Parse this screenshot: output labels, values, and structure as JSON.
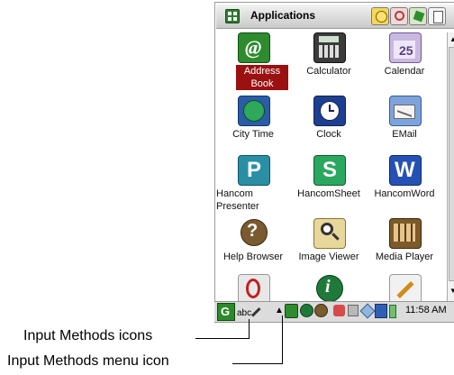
{
  "window": {
    "title": "Applications"
  },
  "apps": [
    {
      "label": "Address Book",
      "icon": "address-book-icon",
      "selected": true
    },
    {
      "label": "Calculator",
      "icon": "calculator-icon",
      "selected": false
    },
    {
      "label": "Calendar",
      "icon": "calendar-icon",
      "selected": false
    },
    {
      "label": "City Time",
      "icon": "city-time-icon",
      "selected": false
    },
    {
      "label": "Clock",
      "icon": "clock-icon",
      "selected": false
    },
    {
      "label": "EMail",
      "icon": "email-icon",
      "selected": false
    },
    {
      "label": "Hancom Presenter",
      "icon": "hancom-presenter-icon",
      "selected": false
    },
    {
      "label": "HancomSheet",
      "icon": "hancom-sheet-icon",
      "selected": false
    },
    {
      "label": "HancomWord",
      "icon": "hancom-word-icon",
      "selected": false
    },
    {
      "label": "Help Browser",
      "icon": "help-browser-icon",
      "selected": false
    },
    {
      "label": "Image Viewer",
      "icon": "image-viewer-icon",
      "selected": false
    },
    {
      "label": "Media Player",
      "icon": "media-player-icon",
      "selected": false
    },
    {
      "label": "",
      "icon": "partial-app-icon-1",
      "selected": false
    },
    {
      "label": "",
      "icon": "partial-app-icon-2",
      "selected": false
    },
    {
      "label": "",
      "icon": "partial-app-icon-3",
      "selected": false
    }
  ],
  "taskbar": {
    "time": "11:58 AM",
    "input_method_text": "abc"
  },
  "callouts": {
    "input_methods_icons": "Input Methods icons",
    "input_methods_menu_icon": "Input Methods menu icon"
  },
  "colors": {
    "selected_label_bg": "#9b1010",
    "screen_bg": "#ffffff",
    "taskbar_bg": "#dcdcdc"
  }
}
